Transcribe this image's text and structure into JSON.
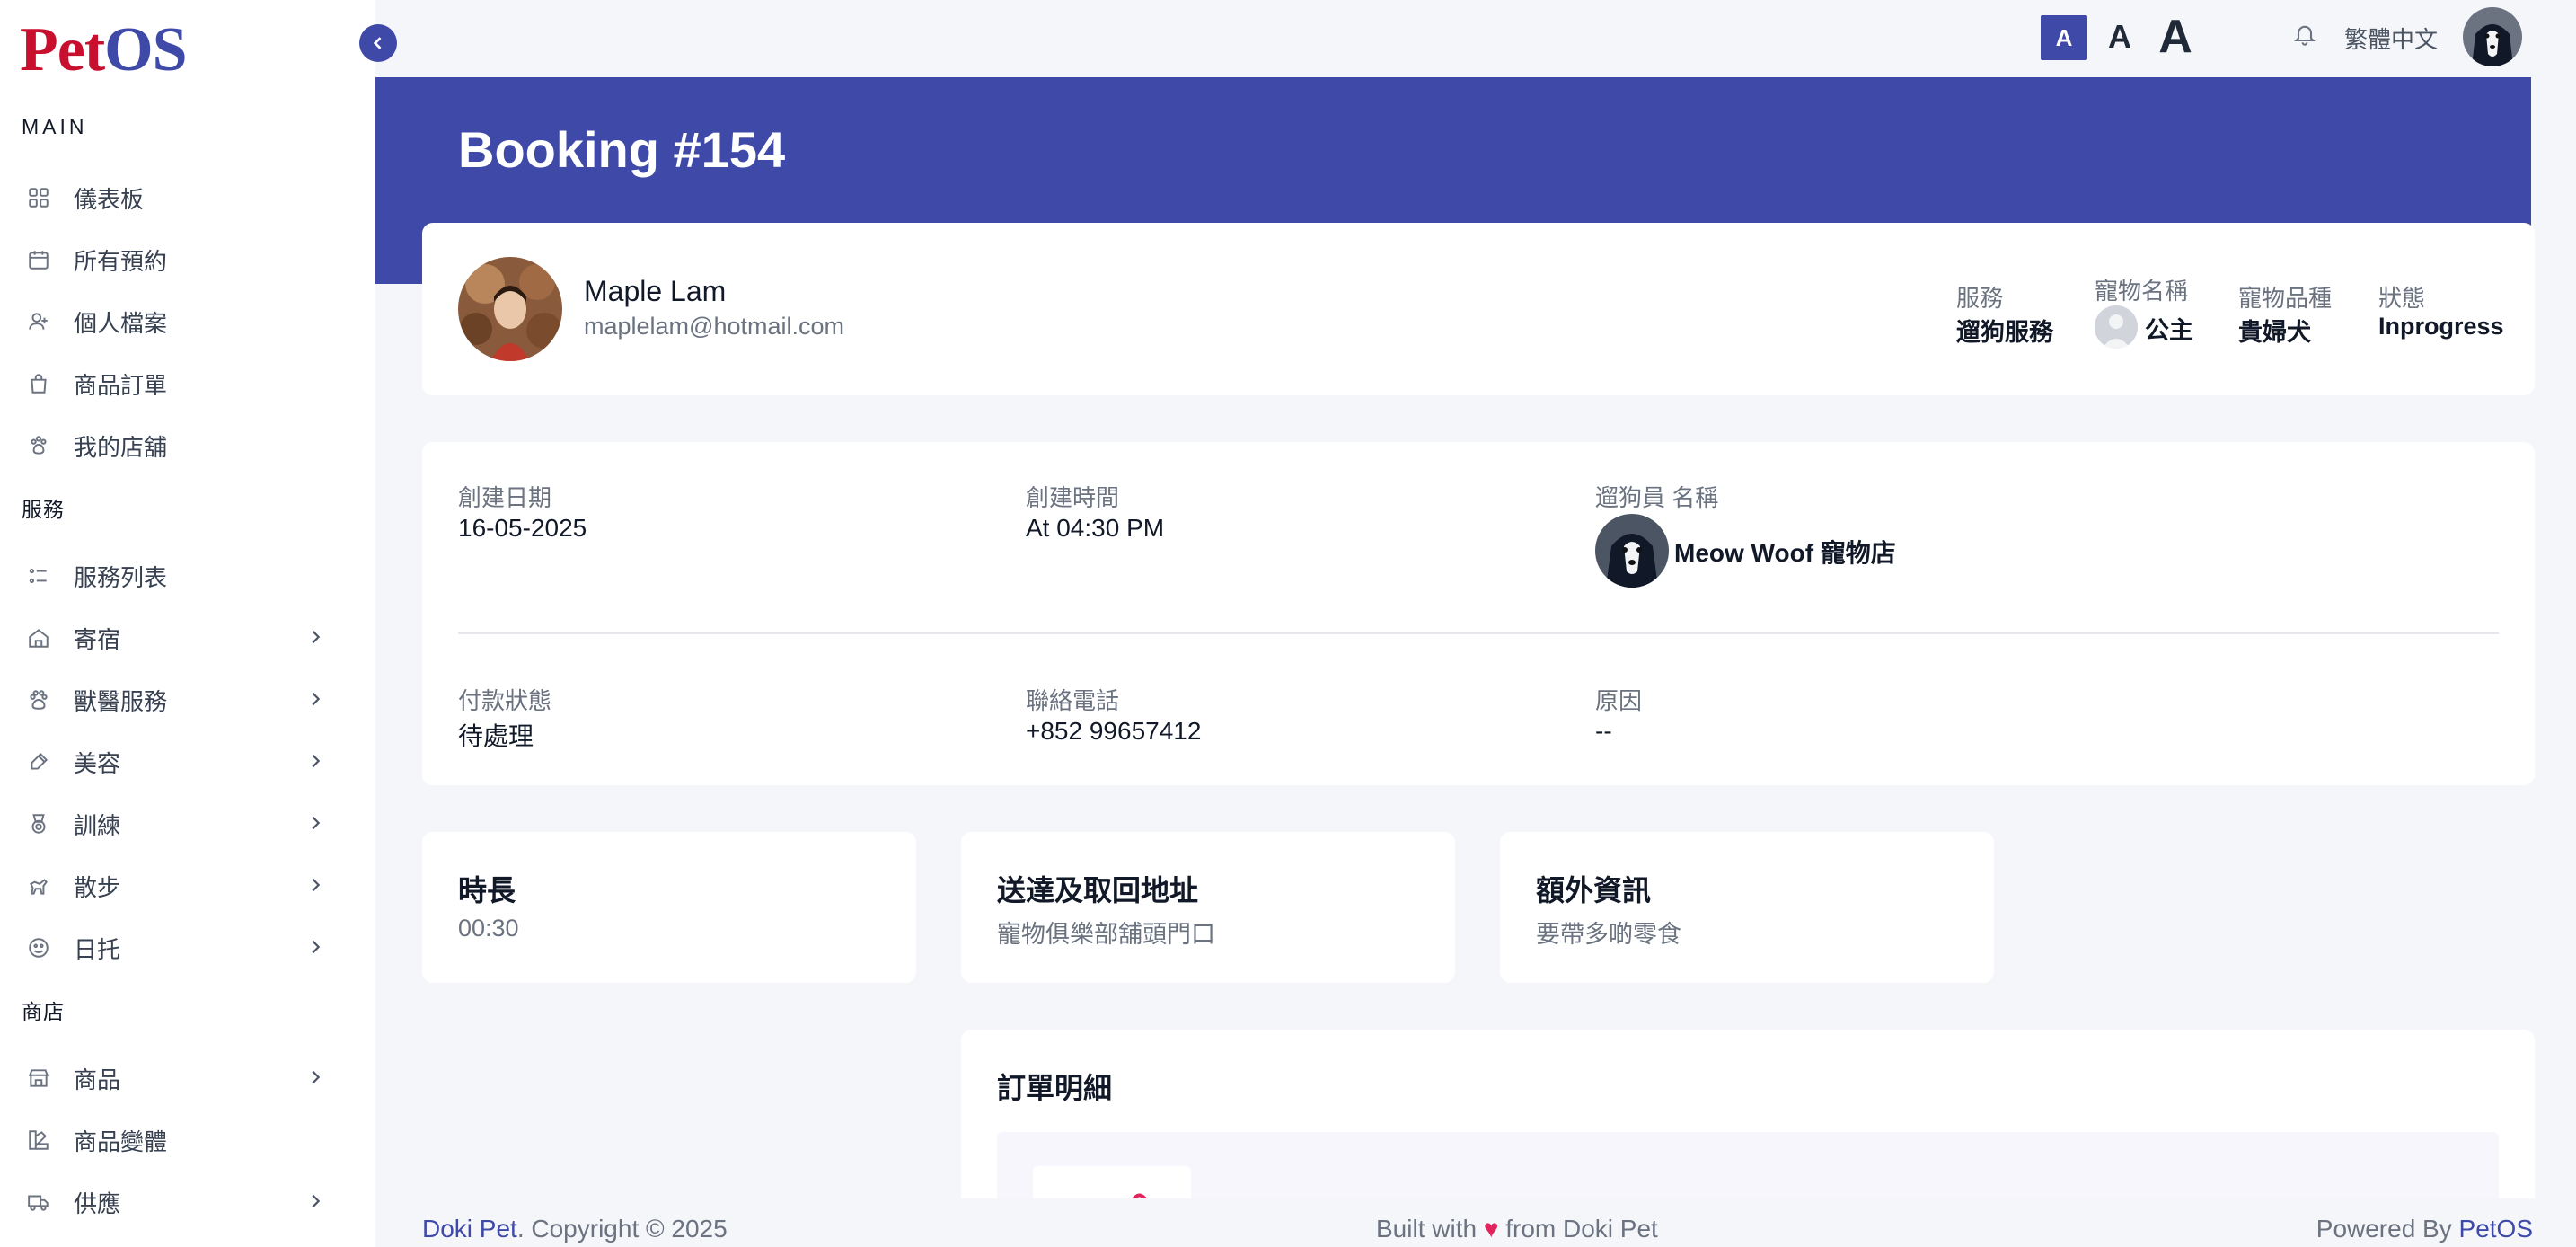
{
  "app": {
    "logo_part1": "Pet",
    "logo_part2": "OS"
  },
  "sidebar": {
    "sections": {
      "main": "MAIN",
      "services": "服務",
      "shop": "商店"
    },
    "items": [
      {
        "label": "儀表板",
        "icon": "dashboard-icon",
        "has_children": false
      },
      {
        "label": "所有預約",
        "icon": "calendar-icon",
        "has_children": false
      },
      {
        "label": "個人檔案",
        "icon": "user-icon",
        "has_children": false
      },
      {
        "label": "商品訂單",
        "icon": "shopping-bag-icon",
        "has_children": false
      },
      {
        "label": "我的店舖",
        "icon": "paw-icon",
        "has_children": false
      },
      {
        "label": "服務列表",
        "icon": "list-icon",
        "has_children": true
      },
      {
        "label": "寄宿",
        "icon": "house-icon",
        "has_children": true
      },
      {
        "label": "獸醫服務",
        "icon": "vet-icon",
        "has_children": true
      },
      {
        "label": "美容",
        "icon": "brush-icon",
        "has_children": true
      },
      {
        "label": "訓練",
        "icon": "medal-icon",
        "has_children": true
      },
      {
        "label": "散步",
        "icon": "dog-walk-icon",
        "has_children": true
      },
      {
        "label": "日托",
        "icon": "daycare-icon",
        "has_children": true
      },
      {
        "label": "商品",
        "icon": "store-icon",
        "has_children": true
      },
      {
        "label": "商品變體",
        "icon": "variant-icon",
        "has_children": false
      },
      {
        "label": "供應",
        "icon": "truck-icon",
        "has_children": true
      }
    ]
  },
  "topbar": {
    "font_small": "A",
    "font_medium": "A",
    "font_large": "A",
    "language": "繁體中文"
  },
  "page": {
    "title": "Booking #154"
  },
  "customer": {
    "name": "Maple Lam",
    "email": "maplelam@hotmail.com"
  },
  "summary": {
    "service_label": "服務",
    "service_value": "遛狗服務",
    "pet_name_label": "寵物名稱",
    "pet_name_value": "公主",
    "pet_breed_label": "寵物品種",
    "pet_breed_value": "貴婦犬",
    "status_label": "狀態",
    "status_value": "Inprogress"
  },
  "details": {
    "created_date_label": "創建日期",
    "created_date_value": "16-05-2025",
    "created_time_label": "創建時間",
    "created_time_value": "At 04:30 PM",
    "walker_label": "遛狗員 名稱",
    "walker_value": "Meow Woof 寵物店",
    "payment_label": "付款狀態",
    "payment_value": "待處理",
    "phone_label": "聯絡電話",
    "phone_value": "+852 99657412",
    "reason_label": "原因",
    "reason_value": "--"
  },
  "cards": {
    "duration_title": "時長",
    "duration_value": "00:30",
    "address_title": "送達及取回地址",
    "address_value": "寵物俱樂部舖頭門口",
    "extra_title": "額外資訊",
    "extra_value": "要帶多啲零食"
  },
  "order": {
    "title": "訂單明細"
  },
  "footer": {
    "left_brand": "Doki Pet",
    "left_text": ". Copyright © 2025",
    "mid_text1": "Built with",
    "mid_heart": "♥",
    "mid_text2": "from Doki Pet",
    "right_text": "Powered By",
    "right_brand": "PetOS"
  },
  "colors": {
    "primary": "#3f4aa8",
    "logo_red": "#c8102e",
    "background": "#f5f6fa"
  }
}
